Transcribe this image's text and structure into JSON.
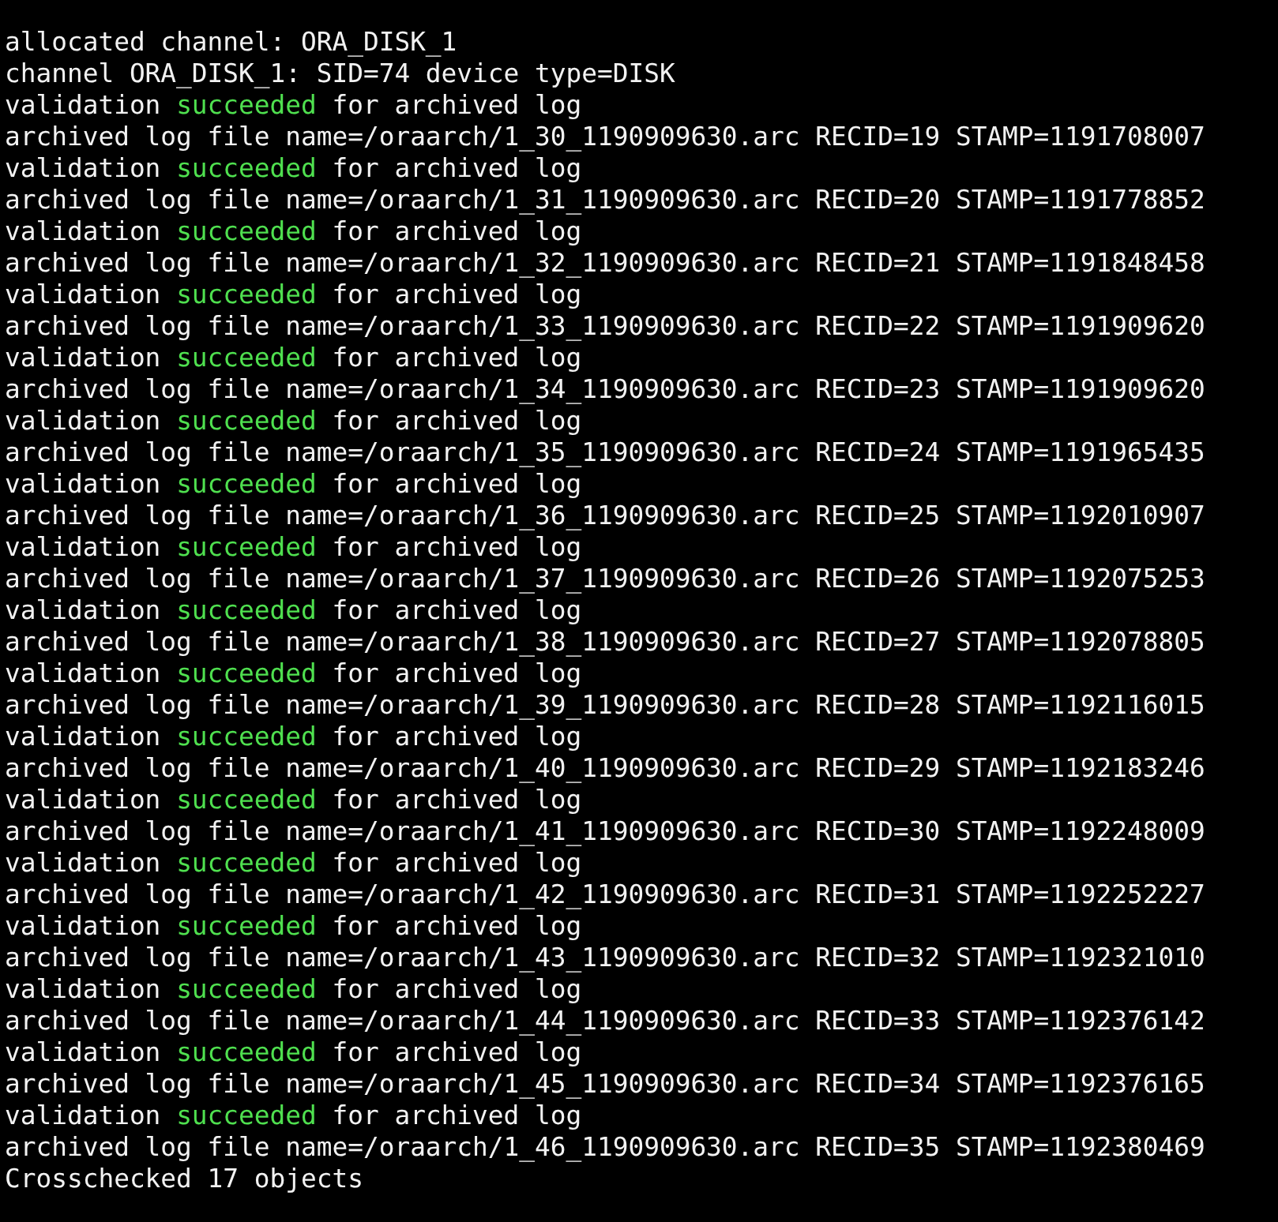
{
  "terminal": {
    "lines": [
      {
        "spans": [
          {
            "text": "allocated channel: ORA_DISK_1",
            "kind": "plain"
          }
        ]
      },
      {
        "spans": [
          {
            "text": "channel ORA_DISK_1: SID=74 device type=DISK",
            "kind": "plain"
          }
        ]
      },
      {
        "spans": [
          {
            "text": "validation ",
            "kind": "plain"
          },
          {
            "text": "succeeded",
            "kind": "success"
          },
          {
            "text": " for archived log",
            "kind": "plain"
          }
        ]
      },
      {
        "spans": [
          {
            "text": "archived log file name=/oraarch/1_30_1190909630.arc RECID=19 STAMP=1191708007",
            "kind": "plain"
          }
        ]
      },
      {
        "spans": [
          {
            "text": "validation ",
            "kind": "plain"
          },
          {
            "text": "succeeded",
            "kind": "success"
          },
          {
            "text": " for archived log",
            "kind": "plain"
          }
        ]
      },
      {
        "spans": [
          {
            "text": "archived log file name=/oraarch/1_31_1190909630.arc RECID=20 STAMP=1191778852",
            "kind": "plain"
          }
        ]
      },
      {
        "spans": [
          {
            "text": "validation ",
            "kind": "plain"
          },
          {
            "text": "succeeded",
            "kind": "success"
          },
          {
            "text": " for archived log",
            "kind": "plain"
          }
        ]
      },
      {
        "spans": [
          {
            "text": "archived log file name=/oraarch/1_32_1190909630.arc RECID=21 STAMP=1191848458",
            "kind": "plain"
          }
        ]
      },
      {
        "spans": [
          {
            "text": "validation ",
            "kind": "plain"
          },
          {
            "text": "succeeded",
            "kind": "success"
          },
          {
            "text": " for archived log",
            "kind": "plain"
          }
        ]
      },
      {
        "spans": [
          {
            "text": "archived log file name=/oraarch/1_33_1190909630.arc RECID=22 STAMP=1191909620",
            "kind": "plain"
          }
        ]
      },
      {
        "spans": [
          {
            "text": "validation ",
            "kind": "plain"
          },
          {
            "text": "succeeded",
            "kind": "success"
          },
          {
            "text": " for archived log",
            "kind": "plain"
          }
        ]
      },
      {
        "spans": [
          {
            "text": "archived log file name=/oraarch/1_34_1190909630.arc RECID=23 STAMP=1191909620",
            "kind": "plain"
          }
        ]
      },
      {
        "spans": [
          {
            "text": "validation ",
            "kind": "plain"
          },
          {
            "text": "succeeded",
            "kind": "success"
          },
          {
            "text": " for archived log",
            "kind": "plain"
          }
        ]
      },
      {
        "spans": [
          {
            "text": "archived log file name=/oraarch/1_35_1190909630.arc RECID=24 STAMP=1191965435",
            "kind": "plain"
          }
        ]
      },
      {
        "spans": [
          {
            "text": "validation ",
            "kind": "plain"
          },
          {
            "text": "succeeded",
            "kind": "success"
          },
          {
            "text": " for archived log",
            "kind": "plain"
          }
        ]
      },
      {
        "spans": [
          {
            "text": "archived log file name=/oraarch/1_36_1190909630.arc RECID=25 STAMP=1192010907",
            "kind": "plain"
          }
        ]
      },
      {
        "spans": [
          {
            "text": "validation ",
            "kind": "plain"
          },
          {
            "text": "succeeded",
            "kind": "success"
          },
          {
            "text": " for archived log",
            "kind": "plain"
          }
        ]
      },
      {
        "spans": [
          {
            "text": "archived log file name=/oraarch/1_37_1190909630.arc RECID=26 STAMP=1192075253",
            "kind": "plain"
          }
        ]
      },
      {
        "spans": [
          {
            "text": "validation ",
            "kind": "plain"
          },
          {
            "text": "succeeded",
            "kind": "success"
          },
          {
            "text": " for archived log",
            "kind": "plain"
          }
        ]
      },
      {
        "spans": [
          {
            "text": "archived log file name=/oraarch/1_38_1190909630.arc RECID=27 STAMP=1192078805",
            "kind": "plain"
          }
        ]
      },
      {
        "spans": [
          {
            "text": "validation ",
            "kind": "plain"
          },
          {
            "text": "succeeded",
            "kind": "success"
          },
          {
            "text": " for archived log",
            "kind": "plain"
          }
        ]
      },
      {
        "spans": [
          {
            "text": "archived log file name=/oraarch/1_39_1190909630.arc RECID=28 STAMP=1192116015",
            "kind": "plain"
          }
        ]
      },
      {
        "spans": [
          {
            "text": "validation ",
            "kind": "plain"
          },
          {
            "text": "succeeded",
            "kind": "success"
          },
          {
            "text": " for archived log",
            "kind": "plain"
          }
        ]
      },
      {
        "spans": [
          {
            "text": "archived log file name=/oraarch/1_40_1190909630.arc RECID=29 STAMP=1192183246",
            "kind": "plain"
          }
        ]
      },
      {
        "spans": [
          {
            "text": "validation ",
            "kind": "plain"
          },
          {
            "text": "succeeded",
            "kind": "success"
          },
          {
            "text": " for archived log",
            "kind": "plain"
          }
        ]
      },
      {
        "spans": [
          {
            "text": "archived log file name=/oraarch/1_41_1190909630.arc RECID=30 STAMP=1192248009",
            "kind": "plain"
          }
        ]
      },
      {
        "spans": [
          {
            "text": "validation ",
            "kind": "plain"
          },
          {
            "text": "succeeded",
            "kind": "success"
          },
          {
            "text": " for archived log",
            "kind": "plain"
          }
        ]
      },
      {
        "spans": [
          {
            "text": "archived log file name=/oraarch/1_42_1190909630.arc RECID=31 STAMP=1192252227",
            "kind": "plain"
          }
        ]
      },
      {
        "spans": [
          {
            "text": "validation ",
            "kind": "plain"
          },
          {
            "text": "succeeded",
            "kind": "success"
          },
          {
            "text": " for archived log",
            "kind": "plain"
          }
        ]
      },
      {
        "spans": [
          {
            "text": "archived log file name=/oraarch/1_43_1190909630.arc RECID=32 STAMP=1192321010",
            "kind": "plain"
          }
        ]
      },
      {
        "spans": [
          {
            "text": "validation ",
            "kind": "plain"
          },
          {
            "text": "succeeded",
            "kind": "success"
          },
          {
            "text": " for archived log",
            "kind": "plain"
          }
        ]
      },
      {
        "spans": [
          {
            "text": "archived log file name=/oraarch/1_44_1190909630.arc RECID=33 STAMP=1192376142",
            "kind": "plain"
          }
        ]
      },
      {
        "spans": [
          {
            "text": "validation ",
            "kind": "plain"
          },
          {
            "text": "succeeded",
            "kind": "success"
          },
          {
            "text": " for archived log",
            "kind": "plain"
          }
        ]
      },
      {
        "spans": [
          {
            "text": "archived log file name=/oraarch/1_45_1190909630.arc RECID=34 STAMP=1192376165",
            "kind": "plain"
          }
        ]
      },
      {
        "spans": [
          {
            "text": "validation ",
            "kind": "plain"
          },
          {
            "text": "succeeded",
            "kind": "success"
          },
          {
            "text": " for archived log",
            "kind": "plain"
          }
        ]
      },
      {
        "spans": [
          {
            "text": "archived log file name=/oraarch/1_46_1190909630.arc RECID=35 STAMP=1192380469",
            "kind": "plain"
          }
        ]
      },
      {
        "spans": [
          {
            "text": "Crosschecked 17 objects",
            "kind": "plain"
          }
        ]
      }
    ]
  }
}
